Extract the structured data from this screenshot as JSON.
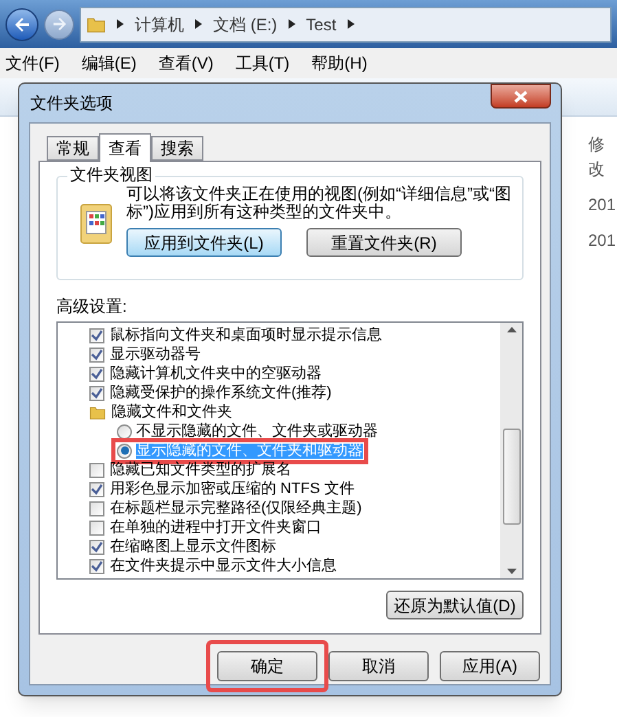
{
  "explorer": {
    "breadcrumb": [
      "计算机",
      "文档 (E:)",
      "Test"
    ],
    "menu": [
      "文件(F)",
      "编辑(E)",
      "查看(V)",
      "工具(T)",
      "帮助(H)"
    ],
    "column_header": "修改",
    "cells": [
      "201",
      "201"
    ]
  },
  "dialog": {
    "title": "文件夹选项",
    "tabs": [
      {
        "label": "常规",
        "selected": false
      },
      {
        "label": "查看",
        "selected": true
      },
      {
        "label": "搜索",
        "selected": false
      }
    ],
    "folder_views": {
      "title": "文件夹视图",
      "description": "可以将该文件夹正在使用的视图(例如“详细信息”或“图标”)应用到所有这种类型的文件夹中。",
      "buttons": [
        {
          "label": "应用到文件夹(L)",
          "focused": true
        },
        {
          "label": "重置文件夹(R)",
          "focused": false
        }
      ]
    },
    "advanced": {
      "label": "高级设置:",
      "items": [
        {
          "kind": "checkbox",
          "label": "鼠标指向文件夹和桌面项时显示提示信息",
          "checked": true
        },
        {
          "kind": "checkbox",
          "label": "显示驱动器号",
          "checked": true
        },
        {
          "kind": "checkbox",
          "label": "隐藏计算机文件夹中的空驱动器",
          "checked": true
        },
        {
          "kind": "checkbox",
          "label": "隐藏受保护的操作系统文件(推荐)",
          "checked": true
        },
        {
          "kind": "folder",
          "label": "隐藏文件和文件夹"
        },
        {
          "kind": "radio",
          "label": "不显示隐藏的文件、文件夹或驱动器",
          "selected": false,
          "highlighted": false
        },
        {
          "kind": "radio",
          "label": "显示隐藏的文件、文件夹和驱动器",
          "selected": true,
          "highlighted": true
        },
        {
          "kind": "checkbox",
          "label": "隐藏已知文件类型的扩展名",
          "checked": false
        },
        {
          "kind": "checkbox",
          "label": "用彩色显示加密或压缩的 NTFS 文件",
          "checked": true
        },
        {
          "kind": "checkbox",
          "label": "在标题栏显示完整路径(仅限经典主题)",
          "checked": false
        },
        {
          "kind": "checkbox",
          "label": "在单独的进程中打开文件夹窗口",
          "checked": false
        },
        {
          "kind": "checkbox",
          "label": "在缩略图上显示文件图标",
          "checked": true
        },
        {
          "kind": "checkbox",
          "label": "在文件夹提示中显示文件大小信息",
          "checked": true
        }
      ]
    },
    "restore_button": "还原为默认值(D)",
    "buttons": [
      {
        "label": "确定",
        "highlighted": true
      },
      {
        "label": "取消",
        "highlighted": false
      },
      {
        "label": "应用(A)",
        "highlighted": false
      }
    ]
  }
}
